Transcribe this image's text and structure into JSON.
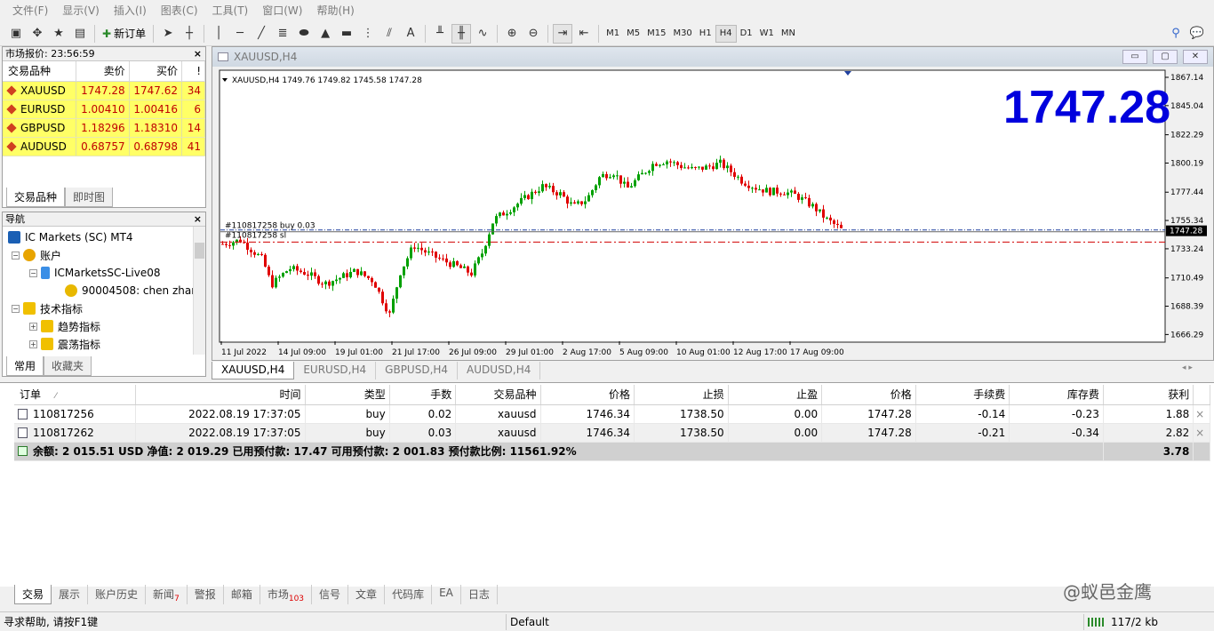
{
  "menu": [
    "文件(F)",
    "显示(V)",
    "插入(I)",
    "图表(C)",
    "工具(T)",
    "窗口(W)",
    "帮助(H)"
  ],
  "toolbar": {
    "new_order": "新订单",
    "timeframes": [
      "M1",
      "M5",
      "M15",
      "M30",
      "H1",
      "H4",
      "D1",
      "W1",
      "MN"
    ],
    "active_tf": "H4"
  },
  "market_watch": {
    "title": "市场报价: 23:56:59",
    "columns": [
      "交易品种",
      "卖价",
      "买价",
      "!"
    ],
    "rows": [
      {
        "symbol": "XAUUSD",
        "bid": "1747.28",
        "ask": "1747.62",
        "spread": "34"
      },
      {
        "symbol": "EURUSD",
        "bid": "1.00410",
        "ask": "1.00416",
        "spread": "6"
      },
      {
        "symbol": "GBPUSD",
        "bid": "1.18296",
        "ask": "1.18310",
        "spread": "14"
      },
      {
        "symbol": "AUDUSD",
        "bid": "0.68757",
        "ask": "0.68798",
        "spread": "41"
      }
    ],
    "tabs": [
      "交易品种",
      "即时图"
    ]
  },
  "navigator": {
    "title": "导航",
    "items": [
      {
        "label": "IC Markets (SC) MT4",
        "color": "#1a5fb4"
      },
      {
        "label": "账户",
        "color": "#e8a400"
      },
      {
        "label": "ICMarketsSC-Live08",
        "color": "#3a8ee6"
      },
      {
        "label": "90004508: chen zhar",
        "color": "#e8b800"
      },
      {
        "label": "技术指标",
        "color": "#f0c000"
      },
      {
        "label": "趋势指标",
        "color": "#f0c000"
      },
      {
        "label": "震荡指标",
        "color": "#f0c000"
      }
    ],
    "tabs": [
      "常用",
      "收藏夹"
    ]
  },
  "chart": {
    "window_title": "XAUUSD,H4",
    "header": "XAUUSD,H4  1749.76 1749.82 1745.58 1747.28",
    "big_price": "1747.28",
    "current_price_label": "1747.28",
    "order_labels": [
      "#110817258 buy 0.03",
      "#110817258 sl"
    ],
    "price_ticks": [
      "1867.14",
      "1845.04",
      "1822.29",
      "1800.19",
      "1777.44",
      "1755.34",
      "1733.24",
      "1710.49",
      "1688.39",
      "1666.29"
    ],
    "time_ticks": [
      "11 Jul 2022",
      "14 Jul 09:00",
      "19 Jul 01:00",
      "21 Jul 17:00",
      "26 Jul 09:00",
      "29 Jul 01:00",
      "2 Aug 17:00",
      "5 Aug 09:00",
      "10 Aug 01:00",
      "12 Aug 17:00",
      "17 Aug 09:00"
    ],
    "tabs": [
      "XAUUSD,H4",
      "EURUSD,H4",
      "GBPUSD,H4",
      "AUDUSD,H4"
    ],
    "up_color": "#00a000",
    "down_color": "#e00000"
  },
  "terminal": {
    "columns": [
      "订单",
      "时间",
      "类型",
      "手数",
      "交易品种",
      "价格",
      "止损",
      "止盈",
      "价格",
      "手续费",
      "库存费",
      "获利"
    ],
    "orders": [
      {
        "ticket": "110817256",
        "time": "2022.08.19 17:37:05",
        "type": "buy",
        "lots": "0.02",
        "symbol": "xauusd",
        "price": "1746.34",
        "sl": "1738.50",
        "tp": "0.00",
        "cur": "1747.28",
        "commission": "-0.14",
        "swap": "-0.23",
        "profit": "1.88"
      },
      {
        "ticket": "110817262",
        "time": "2022.08.19 17:37:05",
        "type": "buy",
        "lots": "0.03",
        "symbol": "xauusd",
        "price": "1746.34",
        "sl": "1738.50",
        "tp": "0.00",
        "cur": "1747.28",
        "commission": "-0.21",
        "swap": "-0.34",
        "profit": "2.82"
      }
    ],
    "summary": "余额: 2 015.51 USD  净值: 2 019.29  已用预付款: 17.47  可用预付款: 2 001.83  预付款比例: 11561.92%",
    "summary_profit": "3.78",
    "tabs": [
      {
        "label": "交易",
        "badge": ""
      },
      {
        "label": "展示",
        "badge": ""
      },
      {
        "label": "账户历史",
        "badge": ""
      },
      {
        "label": "新闻",
        "badge": "7"
      },
      {
        "label": "警报",
        "badge": ""
      },
      {
        "label": "邮箱",
        "badge": ""
      },
      {
        "label": "市场",
        "badge": "103"
      },
      {
        "label": "信号",
        "badge": ""
      },
      {
        "label": "文章",
        "badge": ""
      },
      {
        "label": "代码库",
        "badge": ""
      },
      {
        "label": "EA",
        "badge": ""
      },
      {
        "label": "日志",
        "badge": ""
      }
    ]
  },
  "status": {
    "help": "寻求帮助, 请按F1键",
    "profile": "Default",
    "traffic": "117/2 kb"
  },
  "watermark": "@蚁邑金鹰"
}
